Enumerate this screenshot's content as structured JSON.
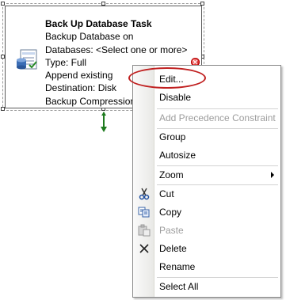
{
  "task": {
    "title": "Back Up Database Task",
    "lines": [
      "Backup Database on",
      "Databases: <Select one or more>",
      "Type: Full",
      "Append existing",
      "Destination: Disk",
      "Backup Compression (D"
    ],
    "status_icon": "error-icon",
    "connector_color": "#1e7b1e"
  },
  "menu": {
    "edit": "Edit...",
    "disable": "Disable",
    "add_precedence": "Add Precedence Constraint",
    "group": "Group",
    "autosize": "Autosize",
    "zoom": "Zoom",
    "cut": "Cut",
    "copy": "Copy",
    "paste": "Paste",
    "delete": "Delete",
    "rename": "Rename",
    "select_all": "Select All"
  },
  "colors": {
    "highlight_ellipse": "#c02020",
    "disabled_text": "#9d9d9d"
  }
}
